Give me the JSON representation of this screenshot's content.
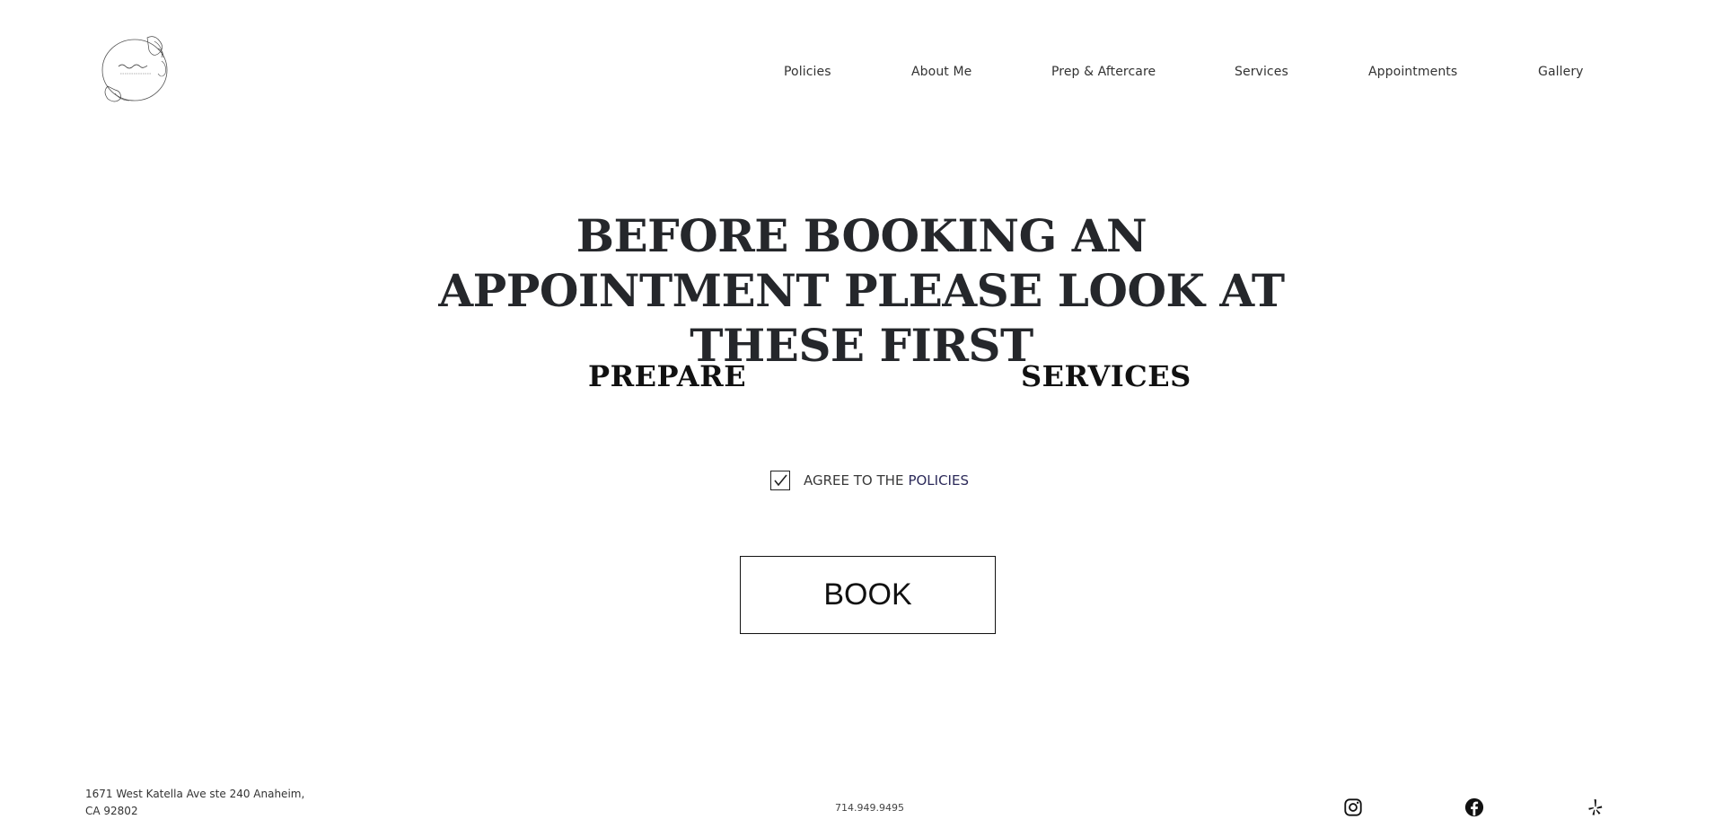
{
  "nav": {
    "items": [
      {
        "label": "Policies"
      },
      {
        "label": "About Me"
      },
      {
        "label": "Prep & Aftercare"
      },
      {
        "label": "Services"
      },
      {
        "label": "Appointments"
      },
      {
        "label": "Gallery"
      }
    ]
  },
  "logo": {
    "icon": "floral-wreath-logo"
  },
  "main": {
    "headline": "BEFORE BOOKING AN APPOINTMENT PLEASE LOOK AT THESE FIRST",
    "links": [
      {
        "label": "PREPARE"
      },
      {
        "label": "SERVICES"
      }
    ],
    "agree": {
      "checked": true,
      "label": "AGREE TO THE",
      "link": "POLICIES"
    },
    "book_label": "BOOK"
  },
  "footer": {
    "address_line1": "1671 West Katella Ave ste 240 Anaheim,",
    "address_line2": "CA 92802",
    "phone": "714.949.9495",
    "social": [
      {
        "icon": "instagram-icon"
      },
      {
        "icon": "facebook-icon"
      },
      {
        "icon": "yelp-icon"
      }
    ]
  },
  "colors": {
    "background": "#ffffff",
    "text": "#25272b",
    "link_accent": "#2c2a5a"
  }
}
